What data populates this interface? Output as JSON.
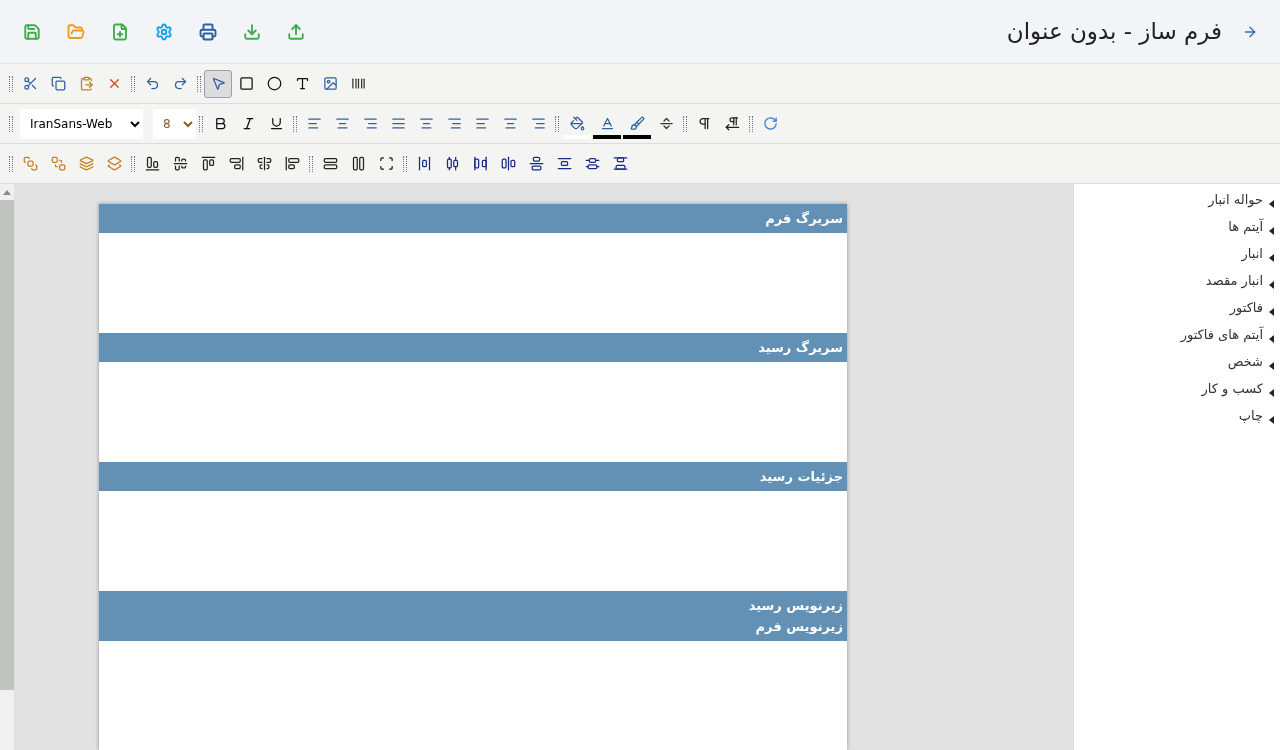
{
  "header": {
    "title": "فرم ساز - بدون عنوان"
  },
  "toolbar": {
    "pointer_tool": {
      "selected": true
    },
    "font_family": "IranSans-Web",
    "font_size": "8",
    "color_swatches": [
      {
        "color": "#ffffff"
      },
      {
        "color": "#000000"
      },
      {
        "color": "#000000"
      }
    ]
  },
  "bands": [
    {
      "titles": [
        "سربرگ فرم"
      ]
    },
    {
      "titles": [
        "سربرگ رسید"
      ]
    },
    {
      "titles": [
        "جزئیات رسید"
      ]
    },
    {
      "titles": [
        "زیرنویس رسید",
        "زیرنویس فرم"
      ]
    }
  ],
  "sidebar": {
    "items": [
      {
        "label": "حواله انبار",
        "expanded": false
      },
      {
        "label": "آیتم ها",
        "expanded": false
      },
      {
        "label": "انبار",
        "expanded": false
      },
      {
        "label": "انبار مقصد",
        "expanded": false
      },
      {
        "label": "فاکتور",
        "expanded": false
      },
      {
        "label": "آیتم های فاکتور",
        "expanded": false
      },
      {
        "label": "شخص",
        "expanded": false
      },
      {
        "label": "کسب و کار",
        "expanded": false
      },
      {
        "label": "چاپ",
        "expanded": false
      }
    ]
  }
}
